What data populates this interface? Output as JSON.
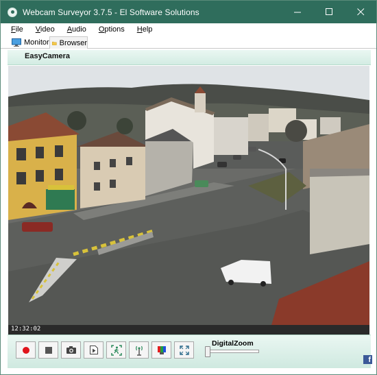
{
  "window": {
    "title": "Webcam Surveyor 3.7.5 - El Software Solutions",
    "controls": [
      "minimize",
      "maximize",
      "close"
    ]
  },
  "menu": [
    {
      "label": "File",
      "underline": "F",
      "rest": "ile"
    },
    {
      "label": "Video",
      "underline": "V",
      "rest": "ideo"
    },
    {
      "label": "Audio",
      "underline": "A",
      "rest": "udio"
    },
    {
      "label": "Options",
      "underline": "O",
      "rest": "ptions"
    },
    {
      "label": "Help",
      "underline": "H",
      "rest": "elp"
    }
  ],
  "tabs": {
    "monitor": {
      "label": "Monitor",
      "icon": "monitor-icon",
      "active": true
    },
    "browser": {
      "label": "Browser",
      "icon": "folder-icon",
      "active": false
    }
  },
  "camera": {
    "name": "EasyCamera",
    "timestamp": "12:32:02"
  },
  "toolbar": {
    "buttons": [
      {
        "name": "record-button",
        "icon": "record-icon"
      },
      {
        "name": "stop-button",
        "icon": "stop-icon"
      },
      {
        "name": "snapshot-button",
        "icon": "camera-icon"
      },
      {
        "name": "playback-button",
        "icon": "video-file-icon"
      },
      {
        "name": "motion-detection-button",
        "icon": "motion-detector-icon"
      },
      {
        "name": "broadcast-button",
        "icon": "antenna-icon"
      },
      {
        "name": "video-settings-button",
        "icon": "color-bars-icon"
      },
      {
        "name": "fullscreen-button",
        "icon": "fullscreen-icon"
      }
    ],
    "zoom_label": "DigitalZoom",
    "zoom_value": 0
  },
  "social": {
    "facebook": "f"
  },
  "colors": {
    "titlebar": "#2f6d5c",
    "panel": "#dcf0e8",
    "record": "#e0141c"
  }
}
